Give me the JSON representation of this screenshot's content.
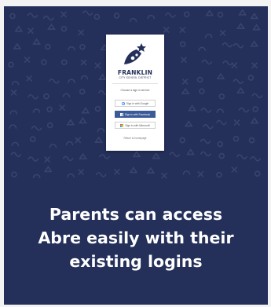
{
  "colors": {
    "background": "#24305a",
    "pattern": "#38446c",
    "facebook": "#3b5a98",
    "logo": "#24305a"
  },
  "login_panel": {
    "logo_icon": "star-rocket-logo-icon",
    "brand_name": "FRANKLIN",
    "brand_subtitle": "CITY SCHOOL DISTRICT",
    "choose_text": "Choose a sign in service",
    "buttons": [
      {
        "label": "Sign in with Google",
        "icon": "google-icon"
      },
      {
        "label": "Sign in with Facebook",
        "icon": "facebook-icon"
      },
      {
        "label": "Sign in with Microsoft",
        "icon": "microsoft-icon"
      }
    ],
    "return_link": "Return to homepage"
  },
  "caption": {
    "lines": [
      "Parents can access",
      "Abre easily with their",
      "existing logins"
    ]
  }
}
